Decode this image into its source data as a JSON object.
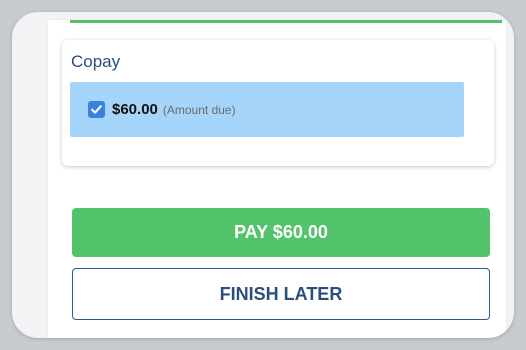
{
  "copay": {
    "title": "Copay",
    "option": {
      "checked": true,
      "amount": "$60.00",
      "note": "(Amount due)"
    }
  },
  "actions": {
    "pay_label": "PAY $60.00",
    "finish_later_label": "FINISH LATER"
  },
  "colors": {
    "primary_green": "#52c26b",
    "navy": "#2a4f7c",
    "selected_bg": "#a6d5fb",
    "checkbox_blue": "#3b82db"
  },
  "icons": {
    "checkbox": "checkmark-icon"
  }
}
